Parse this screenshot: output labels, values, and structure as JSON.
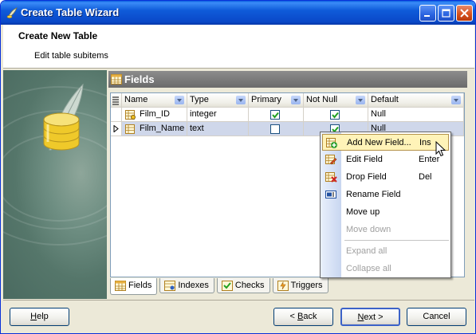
{
  "window": {
    "title": "Create Table Wizard"
  },
  "header": {
    "title": "Create New Table",
    "subtitle": "Edit table subitems"
  },
  "fields_panel": {
    "title": "Fields",
    "columns": [
      {
        "label": "Name"
      },
      {
        "label": "Type"
      },
      {
        "label": "Primary"
      },
      {
        "label": "Not Null"
      },
      {
        "label": "Default"
      }
    ],
    "rows": [
      {
        "name": "Film_ID",
        "type": "integer",
        "primary": true,
        "not_null": true,
        "default": "Null",
        "selected": false
      },
      {
        "name": "Film_Name",
        "type": "text",
        "primary": false,
        "not_null": true,
        "default": "Null",
        "selected": true
      }
    ]
  },
  "tabs": [
    {
      "label": "Fields",
      "icon": "fields-tab-icon",
      "active": true
    },
    {
      "label": "Indexes",
      "icon": "indexes-tab-icon",
      "active": false
    },
    {
      "label": "Checks",
      "icon": "checks-tab-icon",
      "active": false
    },
    {
      "label": "Triggers",
      "icon": "triggers-tab-icon",
      "active": false
    }
  ],
  "context_menu": {
    "items": [
      {
        "label": "Add New Field...",
        "shortcut": "Ins",
        "icon": "add-field-icon",
        "enabled": true,
        "highlighted": true
      },
      {
        "label": "Edit Field",
        "shortcut": "Enter",
        "icon": "edit-field-icon",
        "enabled": true
      },
      {
        "label": "Drop Field",
        "shortcut": "Del",
        "icon": "drop-field-icon",
        "enabled": true
      },
      {
        "label": "Rename Field",
        "shortcut": "",
        "icon": "rename-field-icon",
        "enabled": true
      },
      {
        "label": "Move up",
        "shortcut": "",
        "icon": "",
        "enabled": true
      },
      {
        "label": "Move down",
        "shortcut": "",
        "icon": "",
        "enabled": false
      },
      {
        "label": "Expand all",
        "shortcut": "",
        "icon": "",
        "enabled": false
      },
      {
        "label": "Collapse all",
        "shortcut": "",
        "icon": "",
        "enabled": false
      }
    ]
  },
  "buttons": {
    "help": "Help",
    "help_mnemonic": "H",
    "help_rest": "elp",
    "back": "< Back",
    "back_pre": "< ",
    "back_mnemonic": "B",
    "back_rest": "ack",
    "next": "Next >",
    "next_mnemonic": "N",
    "next_rest": "ext >",
    "cancel": "Cancel"
  },
  "colors": {
    "titlebar": "#0a48c8",
    "menu_highlight": "#fff3b8",
    "selected_row": "#cfd7ea"
  }
}
